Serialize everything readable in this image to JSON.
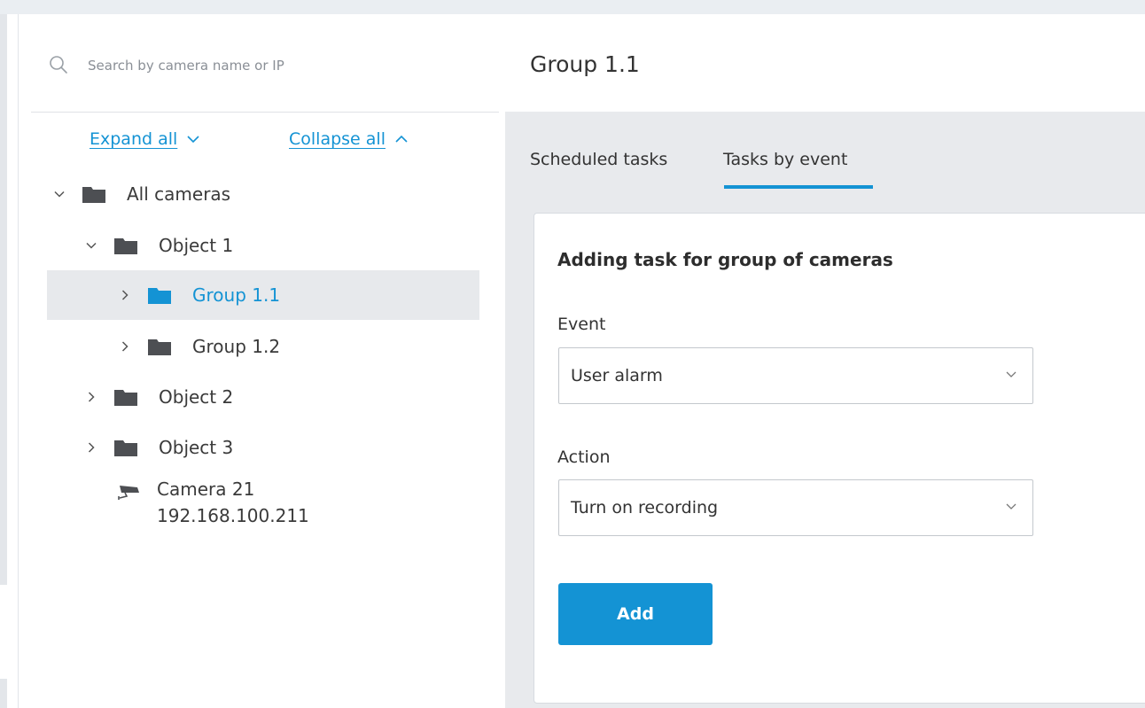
{
  "search": {
    "placeholder": "Search by camera name or IP"
  },
  "tree_controls": {
    "expand_all": "Expand all",
    "collapse_all": "Collapse all"
  },
  "tree": {
    "all_cameras": "All cameras",
    "object_1": "Object 1",
    "group_1_1": "Group 1.1",
    "group_1_2": "Group 1.2",
    "object_2": "Object 2",
    "object_3": "Object 3",
    "camera_name": "Camera 21",
    "camera_ip": "192.168.100.211"
  },
  "main": {
    "title": "Group 1.1",
    "tabs": [
      {
        "label": "Scheduled tasks",
        "active": false
      },
      {
        "label": "Tasks by event",
        "active": true
      }
    ],
    "card": {
      "title": "Adding task for group of cameras",
      "event_label": "Event",
      "event_value": "User alarm",
      "action_label": "Action",
      "action_value": "Turn on recording",
      "add_button": "Add"
    }
  },
  "colors": {
    "accent": "#1493d4",
    "folder": "#4d4f53",
    "selected_row_bg": "#e7e9ec",
    "main_bg": "#e8eaed"
  },
  "icons": {
    "search": "search-icon",
    "folder": "folder-icon",
    "camera": "camera-icon",
    "chevron_down": "chevron-down-icon",
    "chevron_right": "chevron-right-icon",
    "chevron_up": "chevron-up-icon"
  }
}
